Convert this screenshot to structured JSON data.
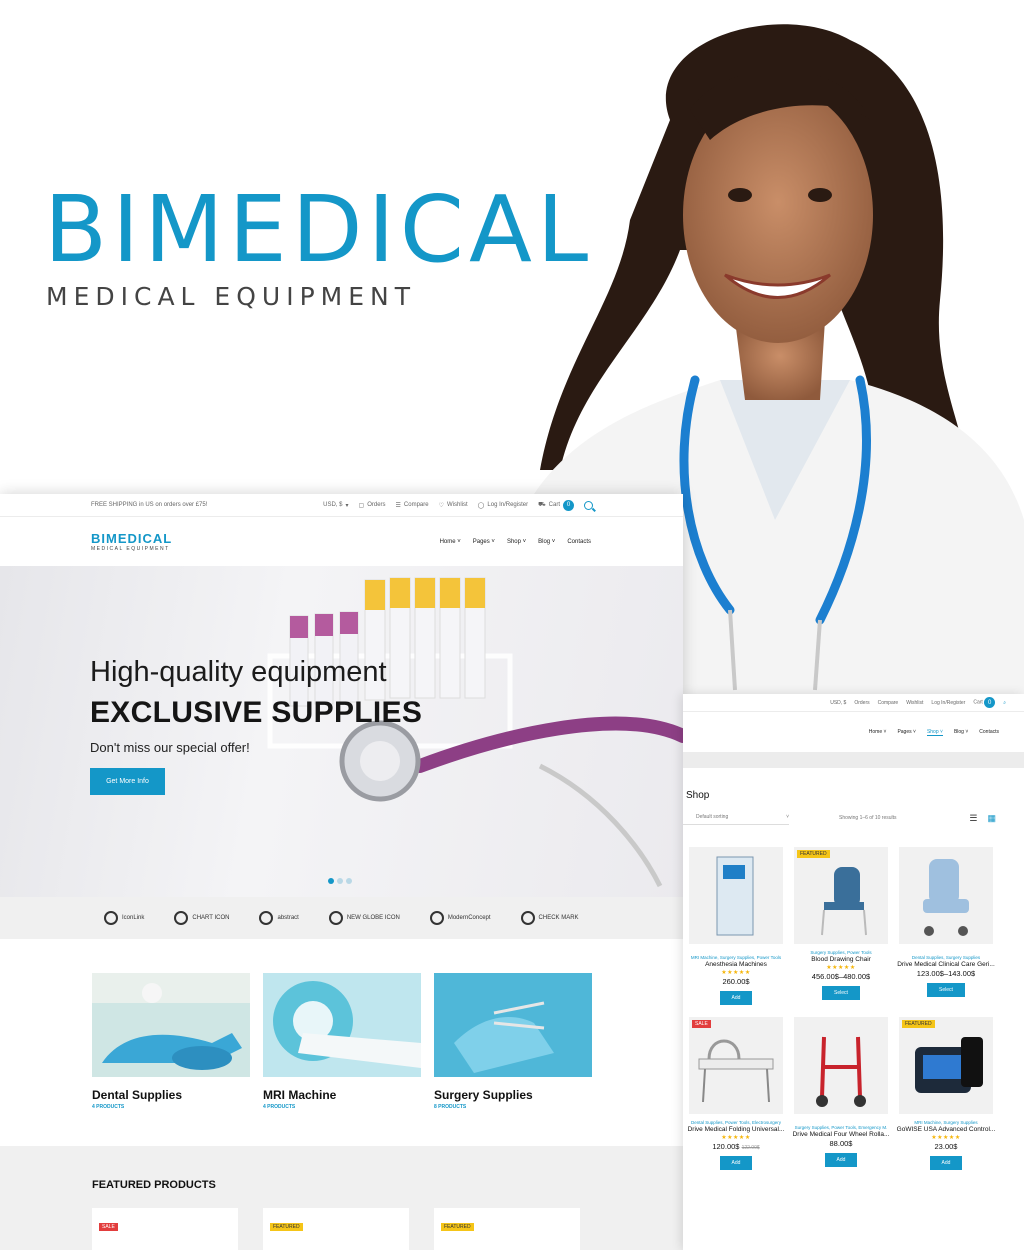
{
  "brand": {
    "title": "BIMEDICAL",
    "subtitle": "MEDICAL EQUIPMENT"
  },
  "colors": {
    "accent": "#1497c8",
    "sale": "#e23d3d",
    "featured": "#f5c518"
  },
  "main": {
    "topbar": {
      "shipping": "FREE SHIPPING in US on orders over £75!",
      "currency": "USD, $",
      "orders": "Orders",
      "compare": "Compare",
      "wishlist": "Wishlist",
      "login": "Log In/Register",
      "cart": "Cart",
      "cart_count": "0"
    },
    "logo": {
      "name": "BIMEDICAL",
      "tagline": "MEDICAL EQUIPMENT"
    },
    "nav": [
      "Home",
      "Pages",
      "Shop",
      "Blog",
      "Contacts"
    ],
    "hero": {
      "line1": "High-quality equipment",
      "line2": "EXCLUSIVE SUPPLIES",
      "line3": "Don't miss our special offer!",
      "button": "Get More Info"
    },
    "brands": [
      "IconLink",
      "CHART ICON",
      "abstract",
      "NEW GLOBE ICON",
      "ModernConcept",
      "CHECK MARK"
    ],
    "categories": [
      {
        "title": "Dental Supplies",
        "count": "4 PRODUCTS"
      },
      {
        "title": "MRI Machine",
        "count": "4 PRODUCTS"
      },
      {
        "title": "Surgery Supplies",
        "count": "8 PRODUCTS"
      }
    ],
    "featured_title": "FEATURED PRODUCTS",
    "featured_badges": [
      "SALE",
      "FEATURED",
      "FEATURED"
    ]
  },
  "shop": {
    "topbar": {
      "currency": "USD, $",
      "orders": "Orders",
      "compare": "Compare",
      "wishlist": "Wishlist",
      "login": "Log In/Register",
      "cart": "Cart",
      "cart_count": "0"
    },
    "nav": [
      "Home",
      "Pages",
      "Shop",
      "Blog",
      "Contacts"
    ],
    "title": "Shop",
    "sort": "Default sorting",
    "count": "Showing 1–6 of 10 results",
    "products": [
      {
        "badge": "",
        "categories": "MRI Machine, Surgery Supplies, Power Tools",
        "name": "Anesthesia Machines",
        "stars": "★★★★★",
        "price": "260.00$",
        "old_price": "",
        "button": "Add"
      },
      {
        "badge": "FEATURED",
        "categories": "Surgery Supplies, Power Tools",
        "name": "Blood Drawing Chair",
        "stars": "★★★★★",
        "price": "456.00$–480.00$",
        "old_price": "",
        "button": "Select"
      },
      {
        "badge": "",
        "categories": "Dental Supplies, Surgery Supplies",
        "name": "Drive Medical Clinical Care Geri...",
        "stars": "",
        "price": "123.00$–143.00$",
        "old_price": "",
        "button": "Select"
      },
      {
        "badge": "SALE",
        "categories": "Dental Supplies, Power Tools, Electrosurgery",
        "name": "Drive Medical Folding Universal...",
        "stars": "★★★★★",
        "price": "120.00$",
        "old_price": "122.00$",
        "button": "Add"
      },
      {
        "badge": "",
        "categories": "Surgery Supplies, Power Tools, Emergency M.",
        "name": "Drive Medical Four Wheel Rolla...",
        "stars": "",
        "price": "88.00$",
        "old_price": "",
        "button": "Add"
      },
      {
        "badge": "FEATURED",
        "categories": "MRI Machine, Surgery Supplies",
        "name": "GoWISE USA Advanced Control...",
        "stars": "★★★★★",
        "price": "23.00$",
        "old_price": "",
        "button": "Add"
      }
    ]
  }
}
